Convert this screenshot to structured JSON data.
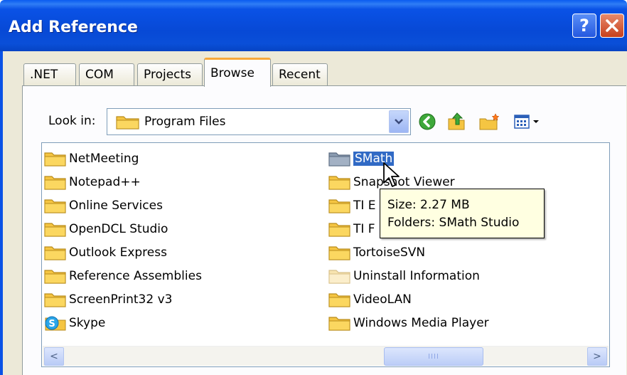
{
  "window": {
    "title": "Add Reference",
    "help_label": "?",
    "close_label": "✕"
  },
  "tabs": [
    {
      "label": ".NET",
      "active": false
    },
    {
      "label": "COM",
      "active": false
    },
    {
      "label": "Projects",
      "active": false
    },
    {
      "label": "Browse",
      "active": true
    },
    {
      "label": "Recent",
      "active": false
    }
  ],
  "look_in": {
    "label": "Look in:",
    "value": "Program Files"
  },
  "toolbar": {
    "icons": [
      "back-icon",
      "up-folder-icon",
      "new-folder-icon",
      "view-menu-icon"
    ]
  },
  "files_left": [
    {
      "name": "NetMeeting",
      "icon": "folder-icon"
    },
    {
      "name": "Notepad++",
      "icon": "folder-icon"
    },
    {
      "name": "Online Services",
      "icon": "folder-icon"
    },
    {
      "name": "OpenDCL Studio",
      "icon": "folder-icon"
    },
    {
      "name": "Outlook Express",
      "icon": "folder-icon"
    },
    {
      "name": "Reference Assemblies",
      "icon": "folder-icon"
    },
    {
      "name": "ScreenPrint32 v3",
      "icon": "folder-icon"
    },
    {
      "name": "Skype",
      "icon": "skype-icon"
    }
  ],
  "files_right": [
    {
      "name": "SMath",
      "icon": "folder-icon",
      "selected": true
    },
    {
      "name": "Snapshot Viewer",
      "icon": "folder-icon"
    },
    {
      "name": "TI E",
      "icon": "folder-icon"
    },
    {
      "name": "TI F",
      "icon": "folder-icon"
    },
    {
      "name": "TortoiseSVN",
      "icon": "folder-icon"
    },
    {
      "name": "Uninstall Information",
      "icon": "folder-pale-icon"
    },
    {
      "name": "VideoLAN",
      "icon": "folder-icon"
    },
    {
      "name": "Windows Media Player",
      "icon": "folder-icon"
    }
  ],
  "tooltip": {
    "size": "Size: 2.27 MB",
    "folders": "Folders: SMath Studio"
  },
  "scrollbar": {
    "left_arrow": "<",
    "right_arrow": ">",
    "grip": "IIII"
  },
  "colors": {
    "titlebar": "#0a52e6",
    "selection": "#316ac5",
    "tab_highlight": "#f7a83a",
    "tooltip_bg": "#ffffe1",
    "folder": "#f5c542"
  }
}
